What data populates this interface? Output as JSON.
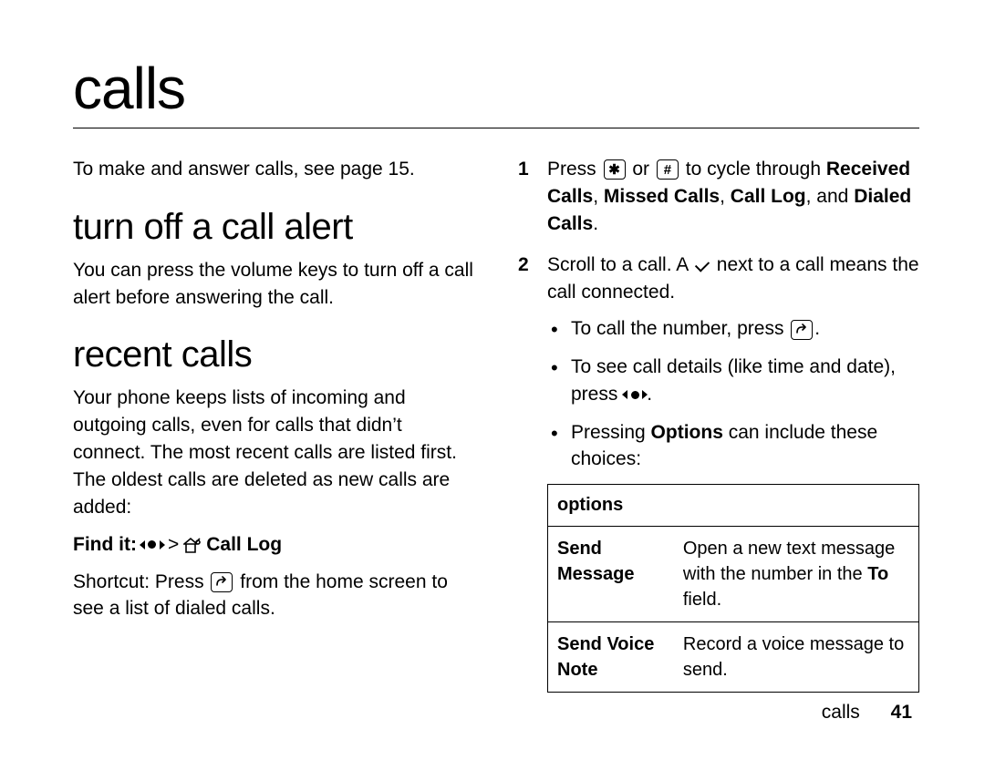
{
  "chapter": "calls",
  "left": {
    "intro": "To make and answer calls, see page 15.",
    "h_alert": "turn off a call alert",
    "alert_body": "You can press the volume keys to turn off a call alert before answering the call.",
    "h_recent": "recent calls",
    "recent_body": "Your phone keeps lists of incoming and outgoing calls, even for calls that didn’t connect. The most recent calls are listed first. The oldest calls are deleted as new calls are added:",
    "findit_label": "Find it:",
    "findit_gt": ">",
    "findit_end": "Call Log",
    "shortcut_label": "Shortcut:",
    "shortcut_a": "Press",
    "shortcut_b": "from the home screen to see a list of dialed calls."
  },
  "right": {
    "step1_a": "Press",
    "step1_or": "or",
    "step1_b": "to cycle through",
    "step1_c1": "Received Calls",
    "step1_c2": "Missed Calls",
    "step1_c3": "Call Log",
    "step1_and": ", and",
    "step1_c4": "Dialed Calls",
    "step2_a": "Scroll to a call. A",
    "step2_b": "next to a call means the call connected.",
    "sub1_a": "To call the number, press",
    "sub2_a": "To see call details (like time and date), press",
    "sub3_a": "Pressing",
    "sub3_b": "Options",
    "sub3_c": "can include these choices:",
    "table": {
      "header": "options",
      "rows": [
        {
          "l": "Send Message",
          "r_a": "Open a new text message with the number in the",
          "r_b": "To",
          "r_c": "field."
        },
        {
          "l": "Send Voice Note",
          "r_a": "Record a voice message to send.",
          "r_b": "",
          "r_c": ""
        }
      ]
    }
  },
  "footer": {
    "section": "calls",
    "page": "41"
  },
  "nums": {
    "one": "1",
    "two": "2"
  },
  "keys": {
    "star": "✱",
    "hash": "#"
  }
}
